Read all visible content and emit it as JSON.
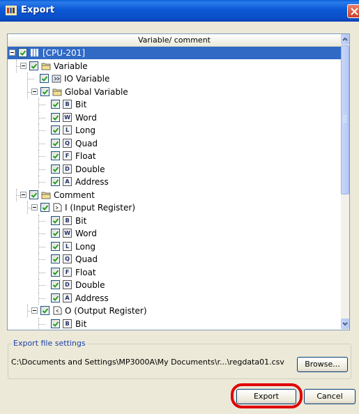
{
  "window": {
    "title": "Export"
  },
  "tree": {
    "header": "Variable/ comment",
    "rows": [
      {
        "label": "[CPU-201]",
        "icon": "cpu-icon"
      },
      {
        "label": "Variable",
        "icon": "folder-icon"
      },
      {
        "label": "IO Variable",
        "icon": "io-variable-icon"
      },
      {
        "label": "Global Variable",
        "icon": "folder-icon"
      },
      {
        "label": "Bit",
        "icon": "B"
      },
      {
        "label": "Word",
        "icon": "W"
      },
      {
        "label": "Long",
        "icon": "L"
      },
      {
        "label": "Quad",
        "icon": "Q"
      },
      {
        "label": "Float",
        "icon": "F"
      },
      {
        "label": "Double",
        "icon": "D"
      },
      {
        "label": "Address",
        "icon": "A"
      },
      {
        "label": "Comment",
        "icon": "folder-icon"
      },
      {
        "label": "I (Input Register)",
        "icon": "input-register-icon"
      },
      {
        "label": "Bit",
        "icon": "B"
      },
      {
        "label": "Word",
        "icon": "W"
      },
      {
        "label": "Long",
        "icon": "L"
      },
      {
        "label": "Quad",
        "icon": "Q"
      },
      {
        "label": "Float",
        "icon": "F"
      },
      {
        "label": "Double",
        "icon": "D"
      },
      {
        "label": "Address",
        "icon": "A"
      },
      {
        "label": "O (Output Register)",
        "icon": "output-register-icon"
      },
      {
        "label": "Bit",
        "icon": "B"
      }
    ]
  },
  "export_settings": {
    "group_label": "Export file settings",
    "path": "C:\\Documents and Settings\\MP3000A\\My Documents\\r...\\regdata01.csv",
    "browse_label": "Browse..."
  },
  "buttons": {
    "export_label": "Export",
    "cancel_label": "Cancel"
  },
  "colors": {
    "titlebar": "#0a58d6",
    "selection": "#316ac5",
    "highlight_ring": "#e00000"
  }
}
